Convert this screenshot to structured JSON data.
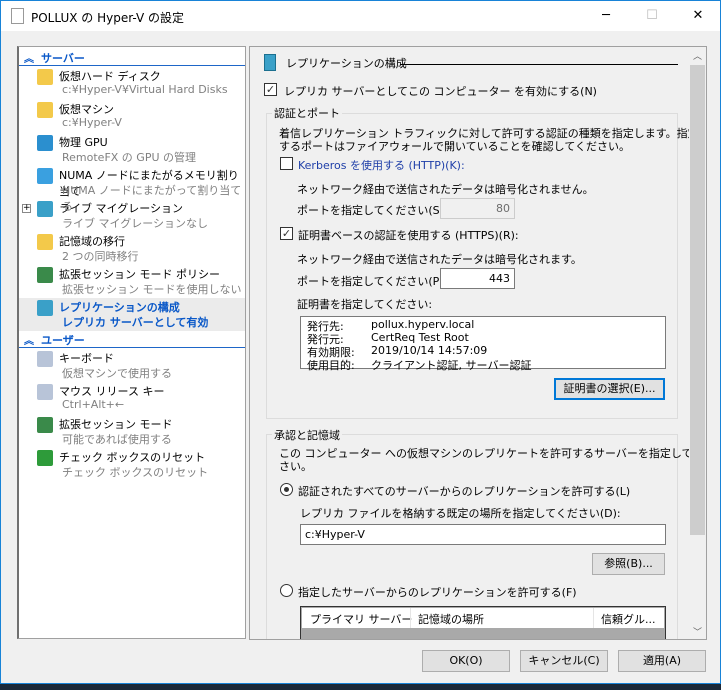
{
  "window": {
    "title": "POLLUX の Hyper-V の設定",
    "minimize": "─",
    "maximize": "☐",
    "close": "✕"
  },
  "tree": {
    "server_section": "サーバー",
    "server_items": [
      {
        "title": "仮想ハード ディスク",
        "subtitle": "c:¥Hyper-V¥Virtual Hard Disks",
        "icon": "virtual-disk-icon"
      },
      {
        "title": "仮想マシン",
        "subtitle": "c:¥Hyper-V",
        "icon": "virtual-machine-folder-icon"
      },
      {
        "title": "物理 GPU",
        "subtitle": "RemoteFX の GPU の管理",
        "icon": "gpu-icon"
      },
      {
        "title": "NUMA ノードにまたがるメモリ割り当て",
        "subtitle": "NUMA ノードにまたがって割り当てる",
        "icon": "monitor-icon"
      },
      {
        "title": "ライブ マイグレーション",
        "subtitle": "ライブ マイグレーションなし",
        "icon": "live-migration-icon"
      },
      {
        "title": "記憶域の移行",
        "subtitle": "2 つの同時移行",
        "icon": "storage-migration-icon"
      },
      {
        "title": "拡張セッション モード ポリシー",
        "subtitle": "拡張セッション モードを使用しない",
        "icon": "enhanced-session-icon"
      },
      {
        "title": "レプリケーションの構成",
        "subtitle": "レプリカ サーバーとして有効",
        "icon": "replication-icon"
      }
    ],
    "user_section": "ユーザー",
    "user_items": [
      {
        "title": "キーボード",
        "subtitle": "仮想マシンで使用する",
        "icon": "keyboard-icon"
      },
      {
        "title": "マウス リリース キー",
        "subtitle": "Ctrl+Alt+←",
        "icon": "mouse-release-icon"
      },
      {
        "title": "拡張セッション モード",
        "subtitle": "可能であれば使用する",
        "icon": "enhanced-session-icon"
      },
      {
        "title": "チェック ボックスのリセット",
        "subtitle": "チェック ボックスのリセット",
        "icon": "reset-checkbox-icon"
      }
    ]
  },
  "main": {
    "header": "レプリケーションの構成",
    "enable_label": "レプリカ サーバーとしてこの コンピューター を有効にする(N)",
    "enable_checked": true,
    "auth": {
      "group_label": "認証とポート",
      "desc1": "着信レプリケーション トラフィックに対して許可する認証の種類を指定します。指定",
      "desc2": "するポートはファイアウォールで開いていることを確認してください。",
      "kerberos_label": "Kerberos を使用する (HTTP)(K):",
      "kerberos_checked": false,
      "kerberos_note": "ネットワーク経由で送信されたデータは暗号化されません。",
      "kerberos_port_label": "ポートを指定してください(S):",
      "kerberos_port": "80",
      "https_label": "証明書ベースの認証を使用する (HTTPS)(R):",
      "https_checked": true,
      "https_note": "ネットワーク経由で送信されたデータは暗号化されます。",
      "https_port_label": "ポートを指定してください(P):",
      "https_port": "443",
      "cert_label": "証明書を指定してください:",
      "cert": [
        {
          "k": "発行先:",
          "v": "pollux.hyperv.local"
        },
        {
          "k": "発行元:",
          "v": "CertReq Test Root"
        },
        {
          "k": "有効期限:",
          "v": "2019/10/14 14:57:09"
        },
        {
          "k": "使用目的:",
          "v": "クライアント認証, サーバー認証"
        }
      ],
      "select_cert_button": "証明書の選択(E)..."
    },
    "storage": {
      "group_label": "承認と記憶域",
      "desc1": "この コンピューター への仮想マシンのレプリケートを許可するサーバーを指定してくだ",
      "desc2": "さい。",
      "all_radio": "認証されたすべてのサーバーからのレプリケーションを許可する(L)",
      "location_label": "レプリカ ファイルを格納する既定の場所を指定してください(D):",
      "location_value": "c:¥Hyper-V",
      "browse_button": "参照(B)...",
      "specified_radio": "指定したサーバーからのレプリケーションを許可する(F)",
      "columns": [
        "プライマリ サーバー",
        "記憶域の場所",
        "信頼グル..."
      ]
    }
  },
  "footer": {
    "ok": "OK(O)",
    "cancel": "キャンセル(C)",
    "apply": "適用(A)"
  }
}
